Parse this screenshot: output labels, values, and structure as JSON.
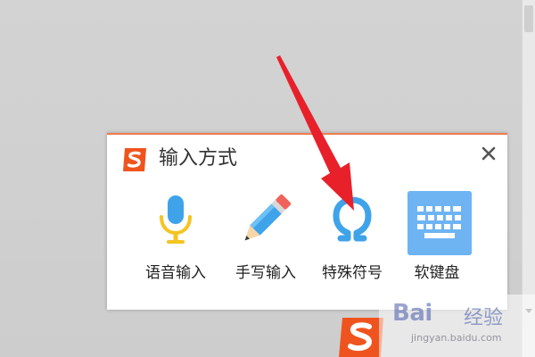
{
  "panel": {
    "title": "输入方式",
    "close_symbol": "×",
    "accent_color": "#ee7d52",
    "tools": [
      {
        "label": "语音输入",
        "icon": "microphone-icon"
      },
      {
        "label": "手写输入",
        "icon": "pencil-icon"
      },
      {
        "label": "特殊符号",
        "icon": "omega-icon"
      },
      {
        "label": "软键盘",
        "icon": "keyboard-icon"
      }
    ]
  },
  "brand": {
    "logo_icon": "sogou-s-logo-icon",
    "logo_color": "#f0541e"
  },
  "annotation": {
    "arrow_color": "#e8202a"
  },
  "watermark": {
    "logo_text": "Bai",
    "cn_text": "经验",
    "url": "jingyan.baidu.com"
  }
}
